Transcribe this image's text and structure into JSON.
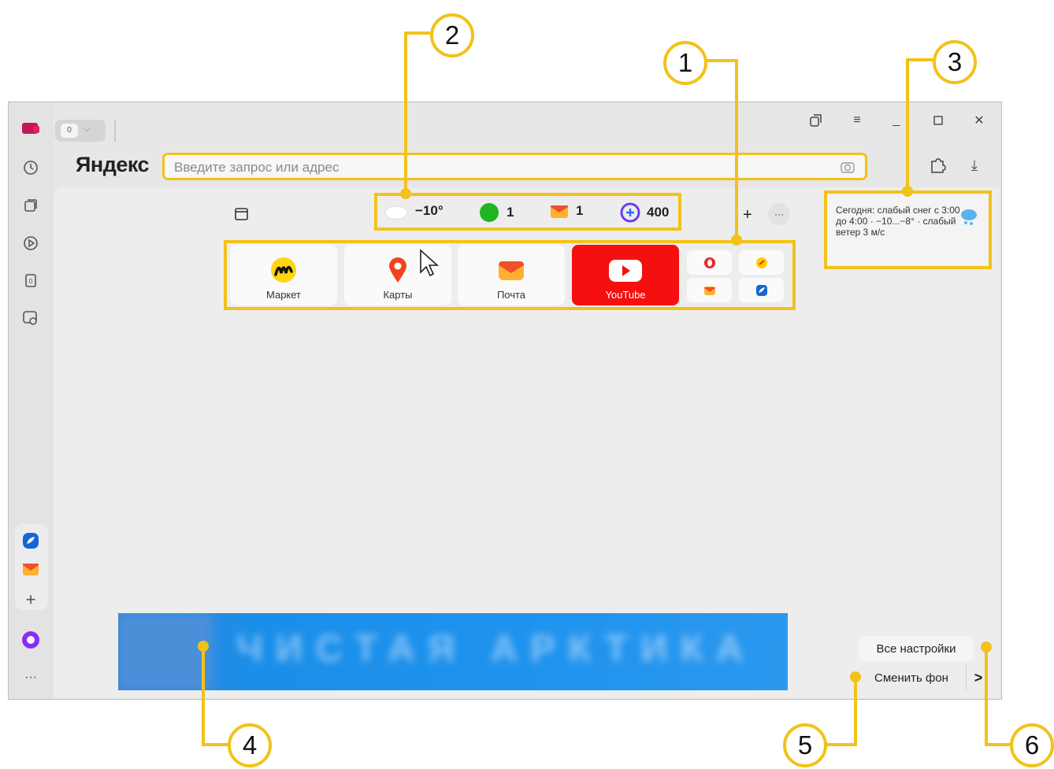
{
  "browser": {
    "logo": "Яндекс",
    "tab_counter": "0",
    "address_placeholder": "Введите запрос или адрес"
  },
  "informers": {
    "weather_temp": "−10°",
    "green_count": "1",
    "mail_count": "1",
    "plus_points": "400"
  },
  "tiles": [
    {
      "label": "Маркет"
    },
    {
      "label": "Карты"
    },
    {
      "label": "Почта"
    },
    {
      "label": "YouTube"
    }
  ],
  "weather_popup": {
    "text": "Сегодня: слабый снег с 3:00 до 4:00 · −10...−8° · слабый ветер 3 м/с"
  },
  "banner": {
    "text": "ЧИСТАЯ АРКТИКА"
  },
  "buttons": {
    "all_settings": "Все настройки",
    "change_background": "Сменить фон",
    "arrow": ">",
    "add": "+",
    "more": "···"
  },
  "callouts": [
    "1",
    "2",
    "3",
    "4",
    "5",
    "6"
  ],
  "colors": {
    "accent": "#f2c21a",
    "youtube_red": "#f50f0f",
    "alice_purple": "#8b2cf5"
  }
}
